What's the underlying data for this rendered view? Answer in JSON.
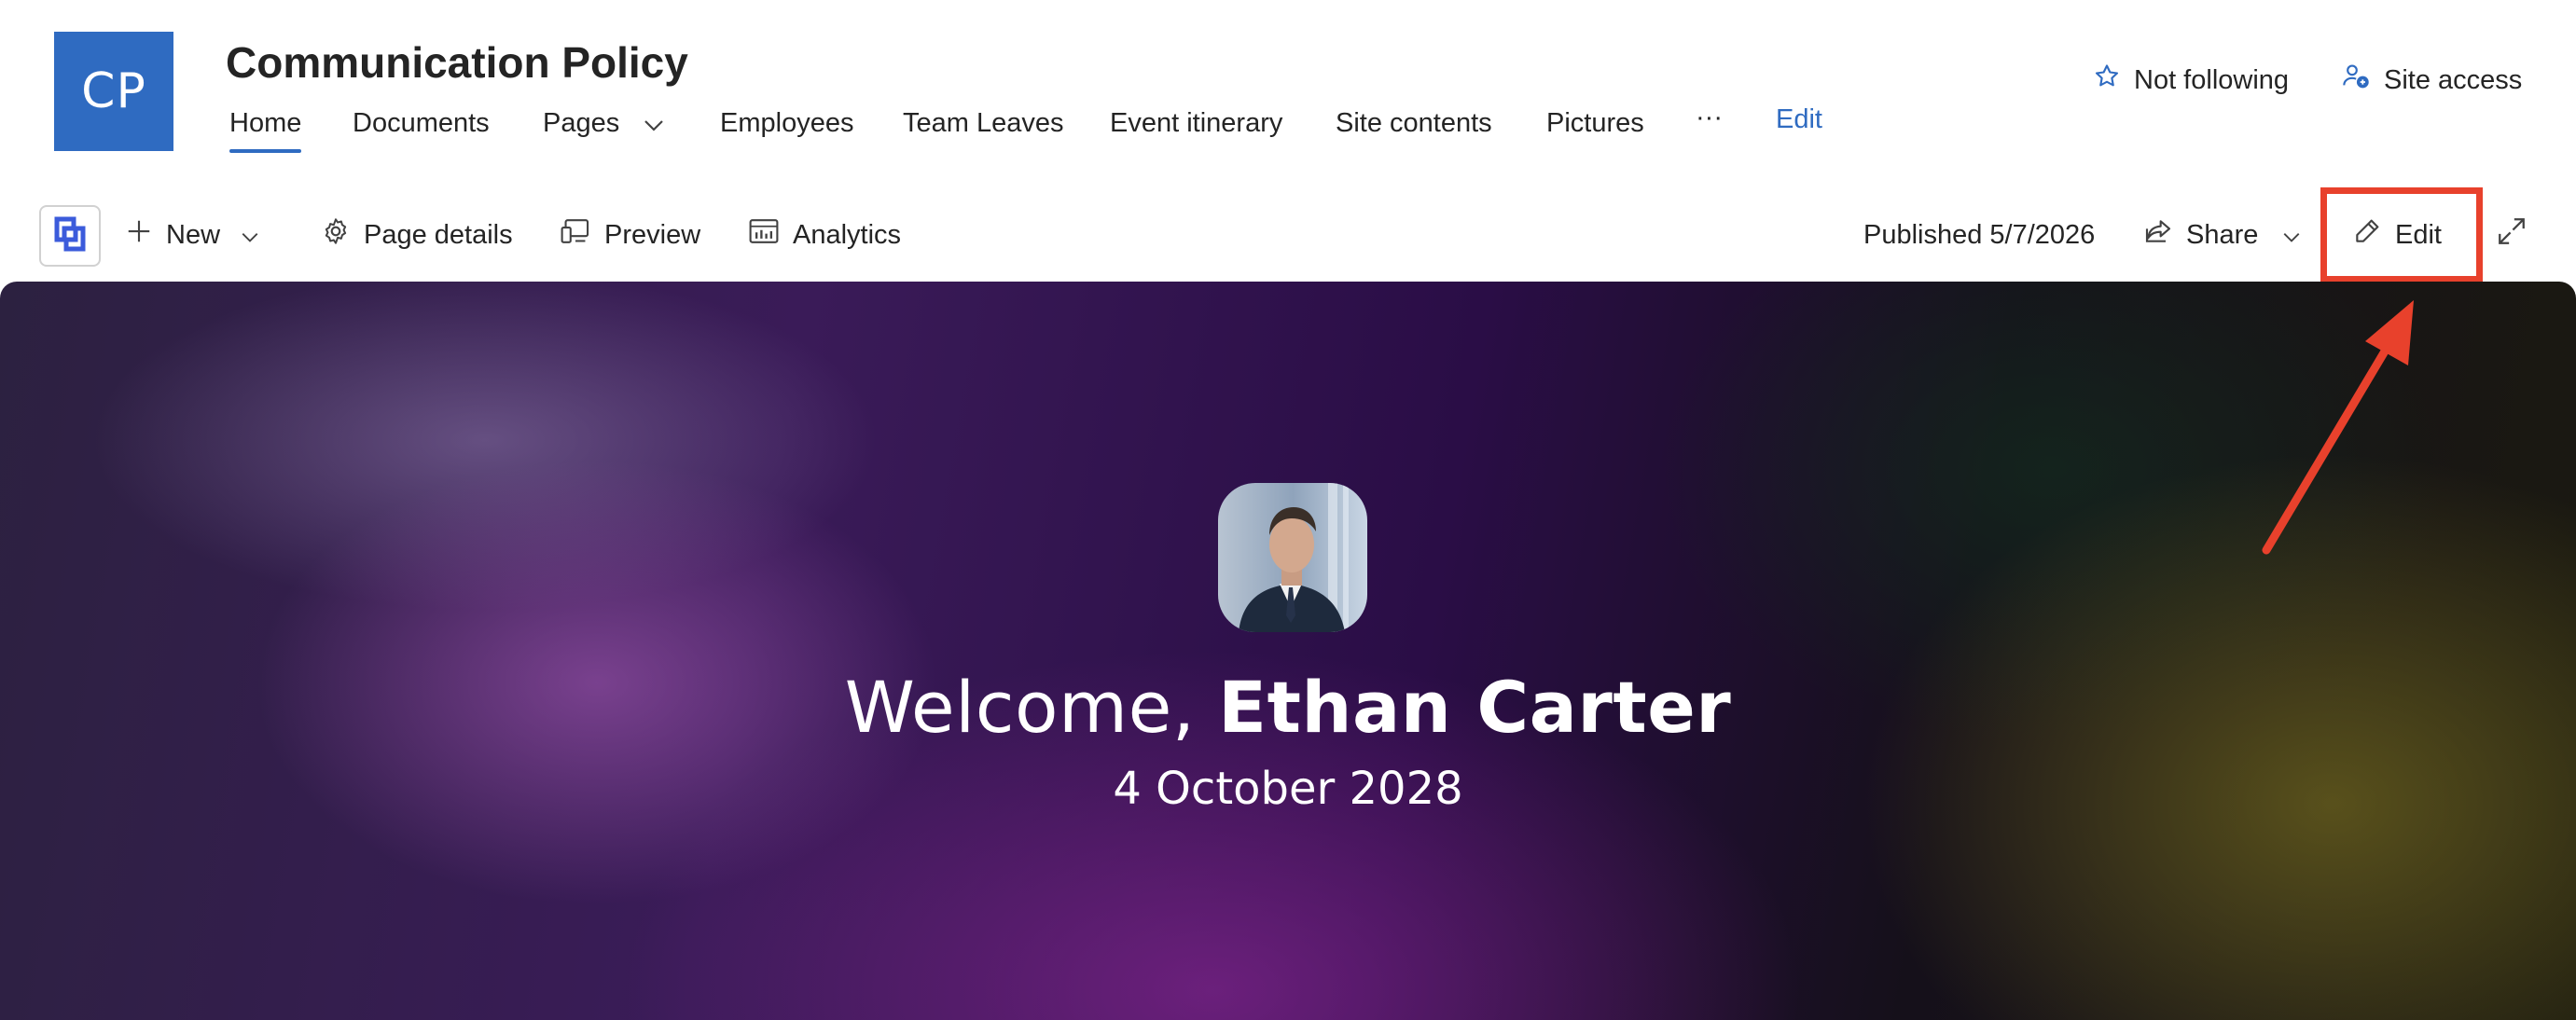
{
  "site": {
    "logo_text": "CP",
    "logo_color": "#2f6bc1",
    "title": "Communication Policy"
  },
  "nav": {
    "items": [
      {
        "label": "Home",
        "active": true
      },
      {
        "label": "Documents"
      },
      {
        "label": "Pages",
        "has_dropdown": true
      },
      {
        "label": "Employees"
      },
      {
        "label": "Team Leaves"
      },
      {
        "label": "Event itinerary"
      },
      {
        "label": "Site contents"
      },
      {
        "label": "Pictures"
      },
      {
        "label": "···"
      },
      {
        "label": "Edit",
        "is_link": true
      }
    ]
  },
  "header_actions": {
    "follow_label": "Not following",
    "follow_icon": "star-icon",
    "access_label": "Site access",
    "access_icon": "site-access-icon"
  },
  "command_bar": {
    "new_label": "New",
    "page_details_label": "Page details",
    "preview_label": "Preview",
    "analytics_label": "Analytics",
    "published_text": "Published 5/7/2026",
    "share_label": "Share",
    "edit_label": "Edit"
  },
  "hero": {
    "welcome_prefix": "Welcome, ",
    "user_name": "Ethan Carter",
    "date": "4 October 2028"
  },
  "annotation": {
    "highlight_color": "#e8412c",
    "highlight_target": "Edit"
  },
  "colors": {
    "accent": "#2f6bc1",
    "text": "#242424"
  }
}
